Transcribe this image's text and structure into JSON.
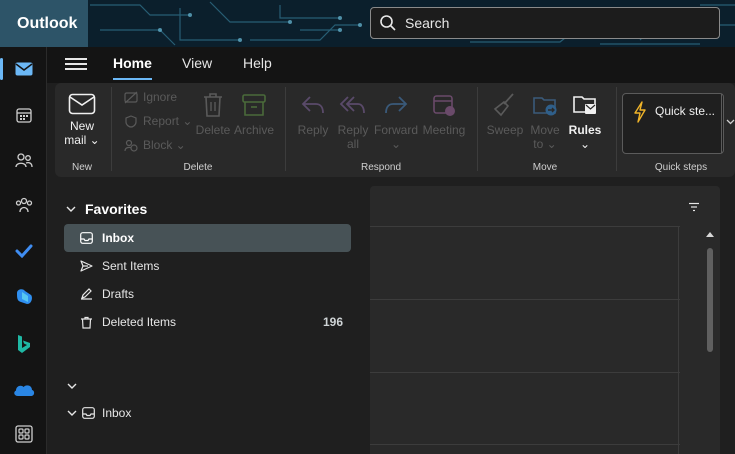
{
  "app": {
    "title": "Outlook"
  },
  "search": {
    "placeholder": "Search"
  },
  "tabs": [
    {
      "label": "Home",
      "active": true
    },
    {
      "label": "View",
      "active": false
    },
    {
      "label": "Help",
      "active": false
    }
  ],
  "ribbon": {
    "new_mail": {
      "line1": "New",
      "line2": "mail ⌄"
    },
    "ignore": "Ignore",
    "report": "Report ⌄",
    "block": "Block ⌄",
    "delete": "Delete",
    "archive": "Archive",
    "reply": "Reply",
    "reply_all": {
      "line1": "Reply",
      "line2": "all"
    },
    "forward": "Forward",
    "forward_caret": "⌄",
    "meeting": "Meeting",
    "sweep": "Sweep",
    "move_to": {
      "line1": "Move",
      "line2": "to ⌄"
    },
    "rules": "Rules",
    "rules_caret": "⌄",
    "quick_steps": "Quick ste...",
    "groups": {
      "new": "New",
      "delete": "Delete",
      "respond": "Respond",
      "move": "Move",
      "quick_steps": "Quick steps"
    }
  },
  "folders": {
    "favorites_label": "Favorites",
    "items": [
      {
        "label": "Inbox",
        "selected": true,
        "icon": "inbox-icon"
      },
      {
        "label": "Sent Items",
        "selected": false,
        "icon": "send-icon"
      },
      {
        "label": "Drafts",
        "selected": false,
        "icon": "pencil-icon"
      },
      {
        "label": "Deleted Items",
        "selected": false,
        "icon": "trash-icon",
        "count": "196"
      }
    ],
    "account_inbox": "Inbox"
  },
  "colors": {
    "accent": "#6cb8f6",
    "selected_bg": "#475256",
    "brand_bg": "#2d5468"
  },
  "rail_icons": [
    "mail-icon",
    "calendar-icon",
    "people-icon",
    "groups-icon",
    "todo-icon",
    "microsoft365-icon",
    "bing-icon",
    "onedrive-icon",
    "apps-icon"
  ]
}
